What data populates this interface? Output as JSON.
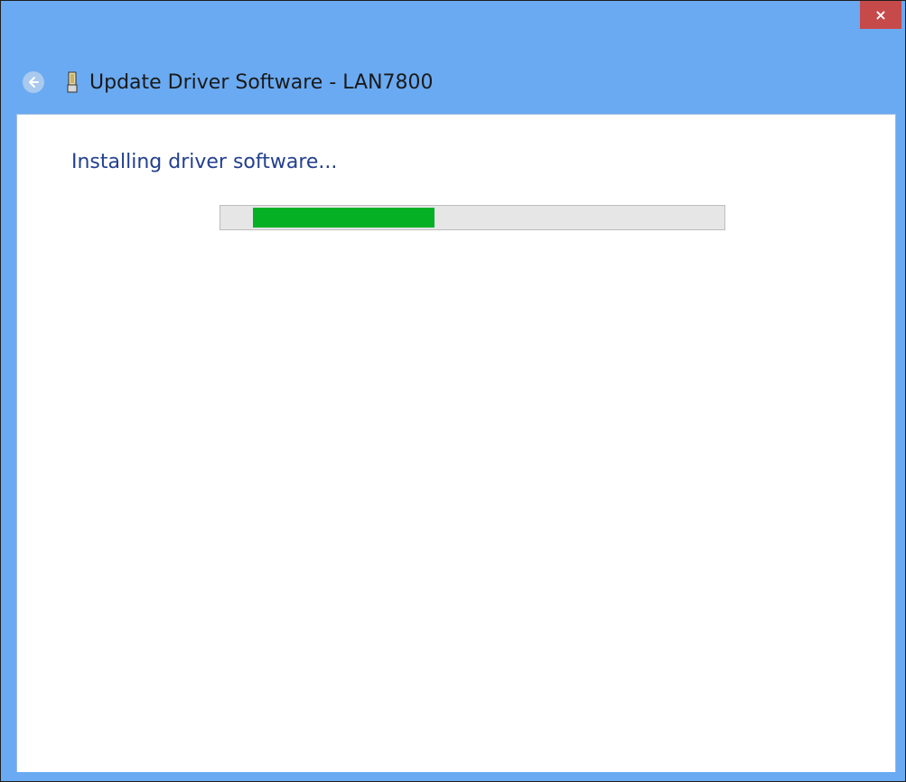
{
  "window": {
    "title": "Update Driver Software - LAN7800",
    "close_label": "×",
    "title_bar_color": "#6aaaf2"
  },
  "icons": {
    "back": "back-arrow-icon",
    "device": "network-adapter-icon",
    "close": "close-icon"
  },
  "main": {
    "heading": "Installing driver software...",
    "progress": {
      "style": "indeterminate-marquee",
      "segment_start_fraction": 0.065,
      "segment_end_fraction": 0.425,
      "fill_color": "#06b025",
      "track_color": "#e6e6e6"
    }
  }
}
